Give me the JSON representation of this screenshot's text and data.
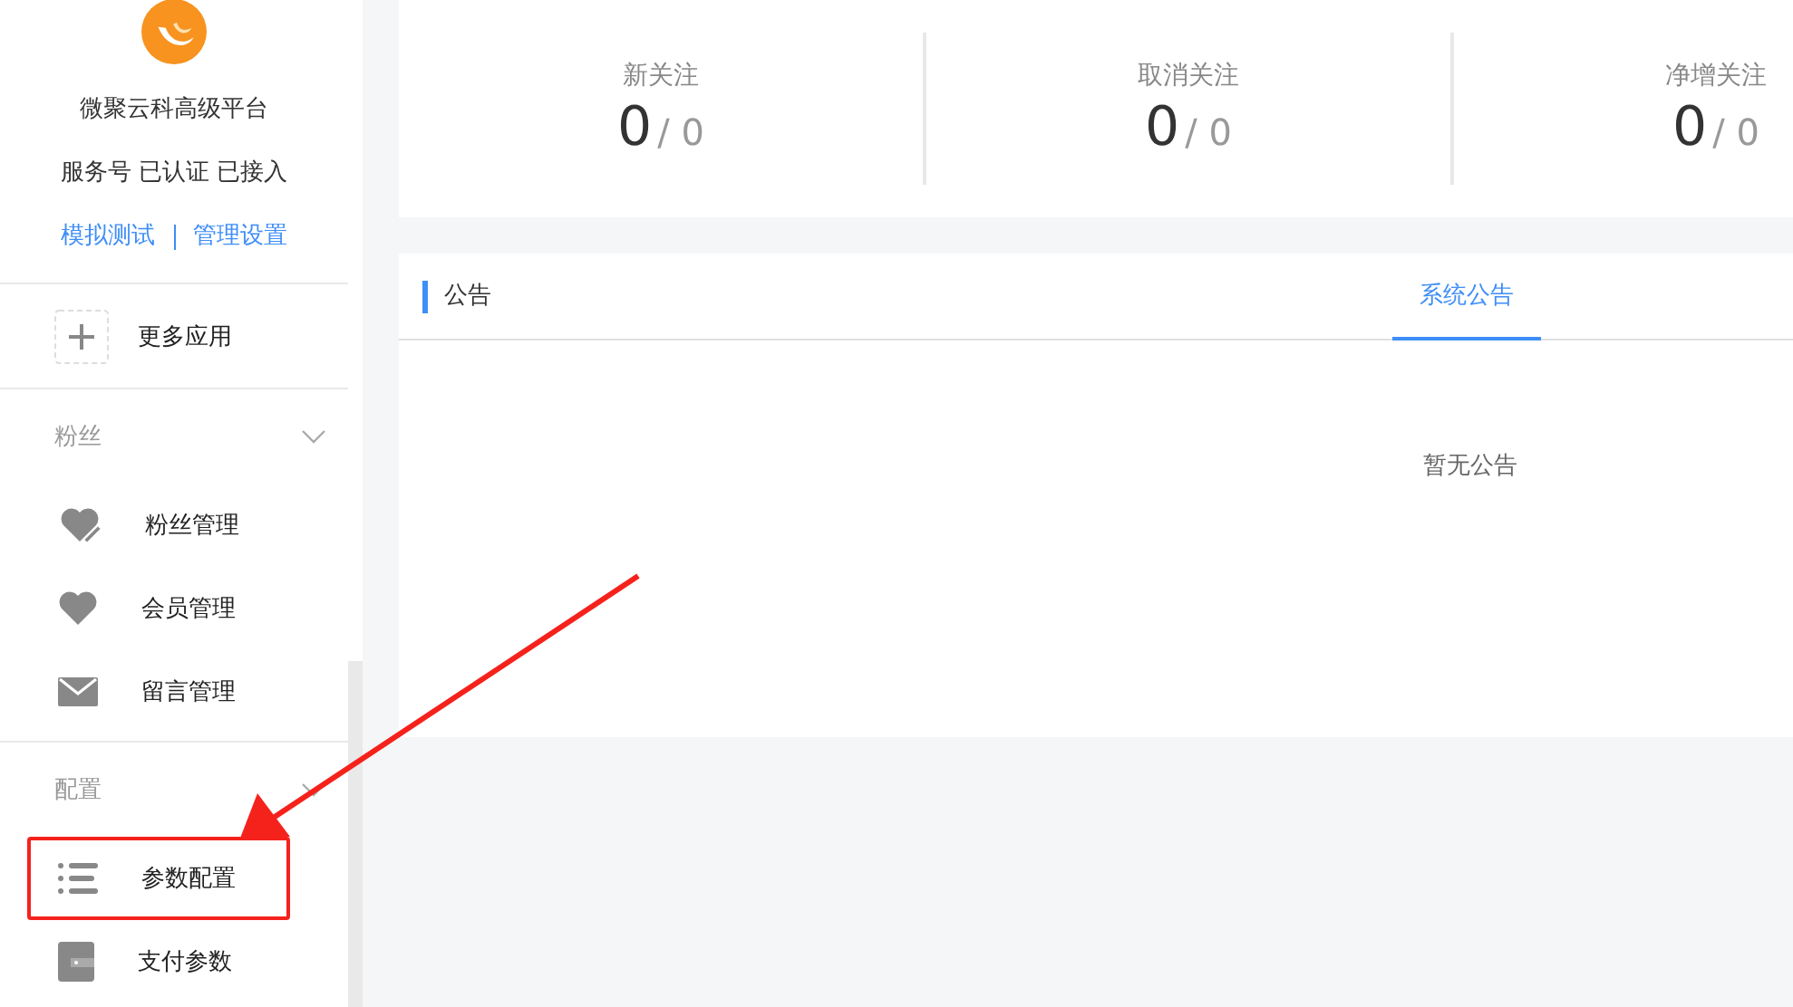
{
  "account": {
    "name": "微聚云科高级平台",
    "status": "服务号 已认证 已接入",
    "links": [
      {
        "label": "模拟测试"
      },
      {
        "label": "管理设置"
      }
    ]
  },
  "more_apps": {
    "label": "更多应用"
  },
  "menu_groups": [
    {
      "title": "粉丝",
      "expanded": true,
      "items": [
        {
          "label": "粉丝管理",
          "kind": "fans",
          "highlighted": false
        },
        {
          "label": "会员管理",
          "kind": "members",
          "highlighted": false
        },
        {
          "label": "留言管理",
          "kind": "messages",
          "highlighted": false
        }
      ]
    },
    {
      "title": "配置",
      "expanded": true,
      "items": [
        {
          "label": "参数配置",
          "kind": "params",
          "highlighted": true
        },
        {
          "label": "支付参数",
          "kind": "payment",
          "highlighted": false
        }
      ]
    }
  ],
  "stats": [
    {
      "label": "新关注",
      "value": "0",
      "total": "/ 0"
    },
    {
      "label": "取消关注",
      "value": "0",
      "total": "/ 0"
    },
    {
      "label": "净增关注",
      "value": "0",
      "total": "/ 0"
    }
  ],
  "notice": {
    "title": "公告",
    "tabs": [
      {
        "label": "系统公告",
        "selected": true
      }
    ],
    "empty_text": "暂无公告"
  }
}
